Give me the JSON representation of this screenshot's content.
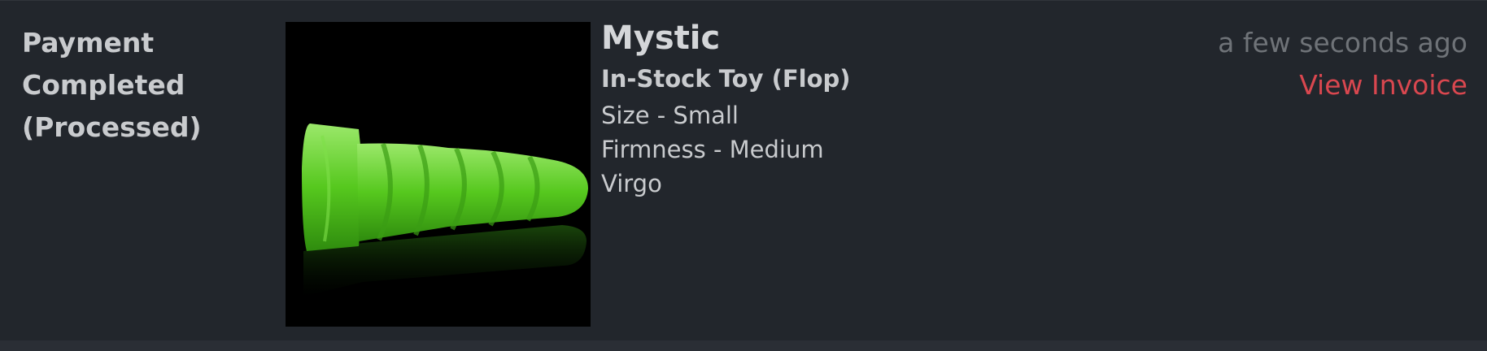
{
  "order": {
    "status_label": "Payment\nCompleted\n(Processed)",
    "product": {
      "name": "Mystic",
      "type": "In-Stock Toy (Flop)",
      "options": [
        "Size - Small",
        "Firmness - Medium",
        "Virgo"
      ],
      "image_alt": "green silicone product photo"
    },
    "timestamp": "a few seconds ago",
    "invoice_label": "View Invoice"
  },
  "colors": {
    "background": "#22262c",
    "text": "#c9cbce",
    "muted": "#6f7378",
    "link": "#d9474f",
    "product_green": "#5fd12a"
  }
}
